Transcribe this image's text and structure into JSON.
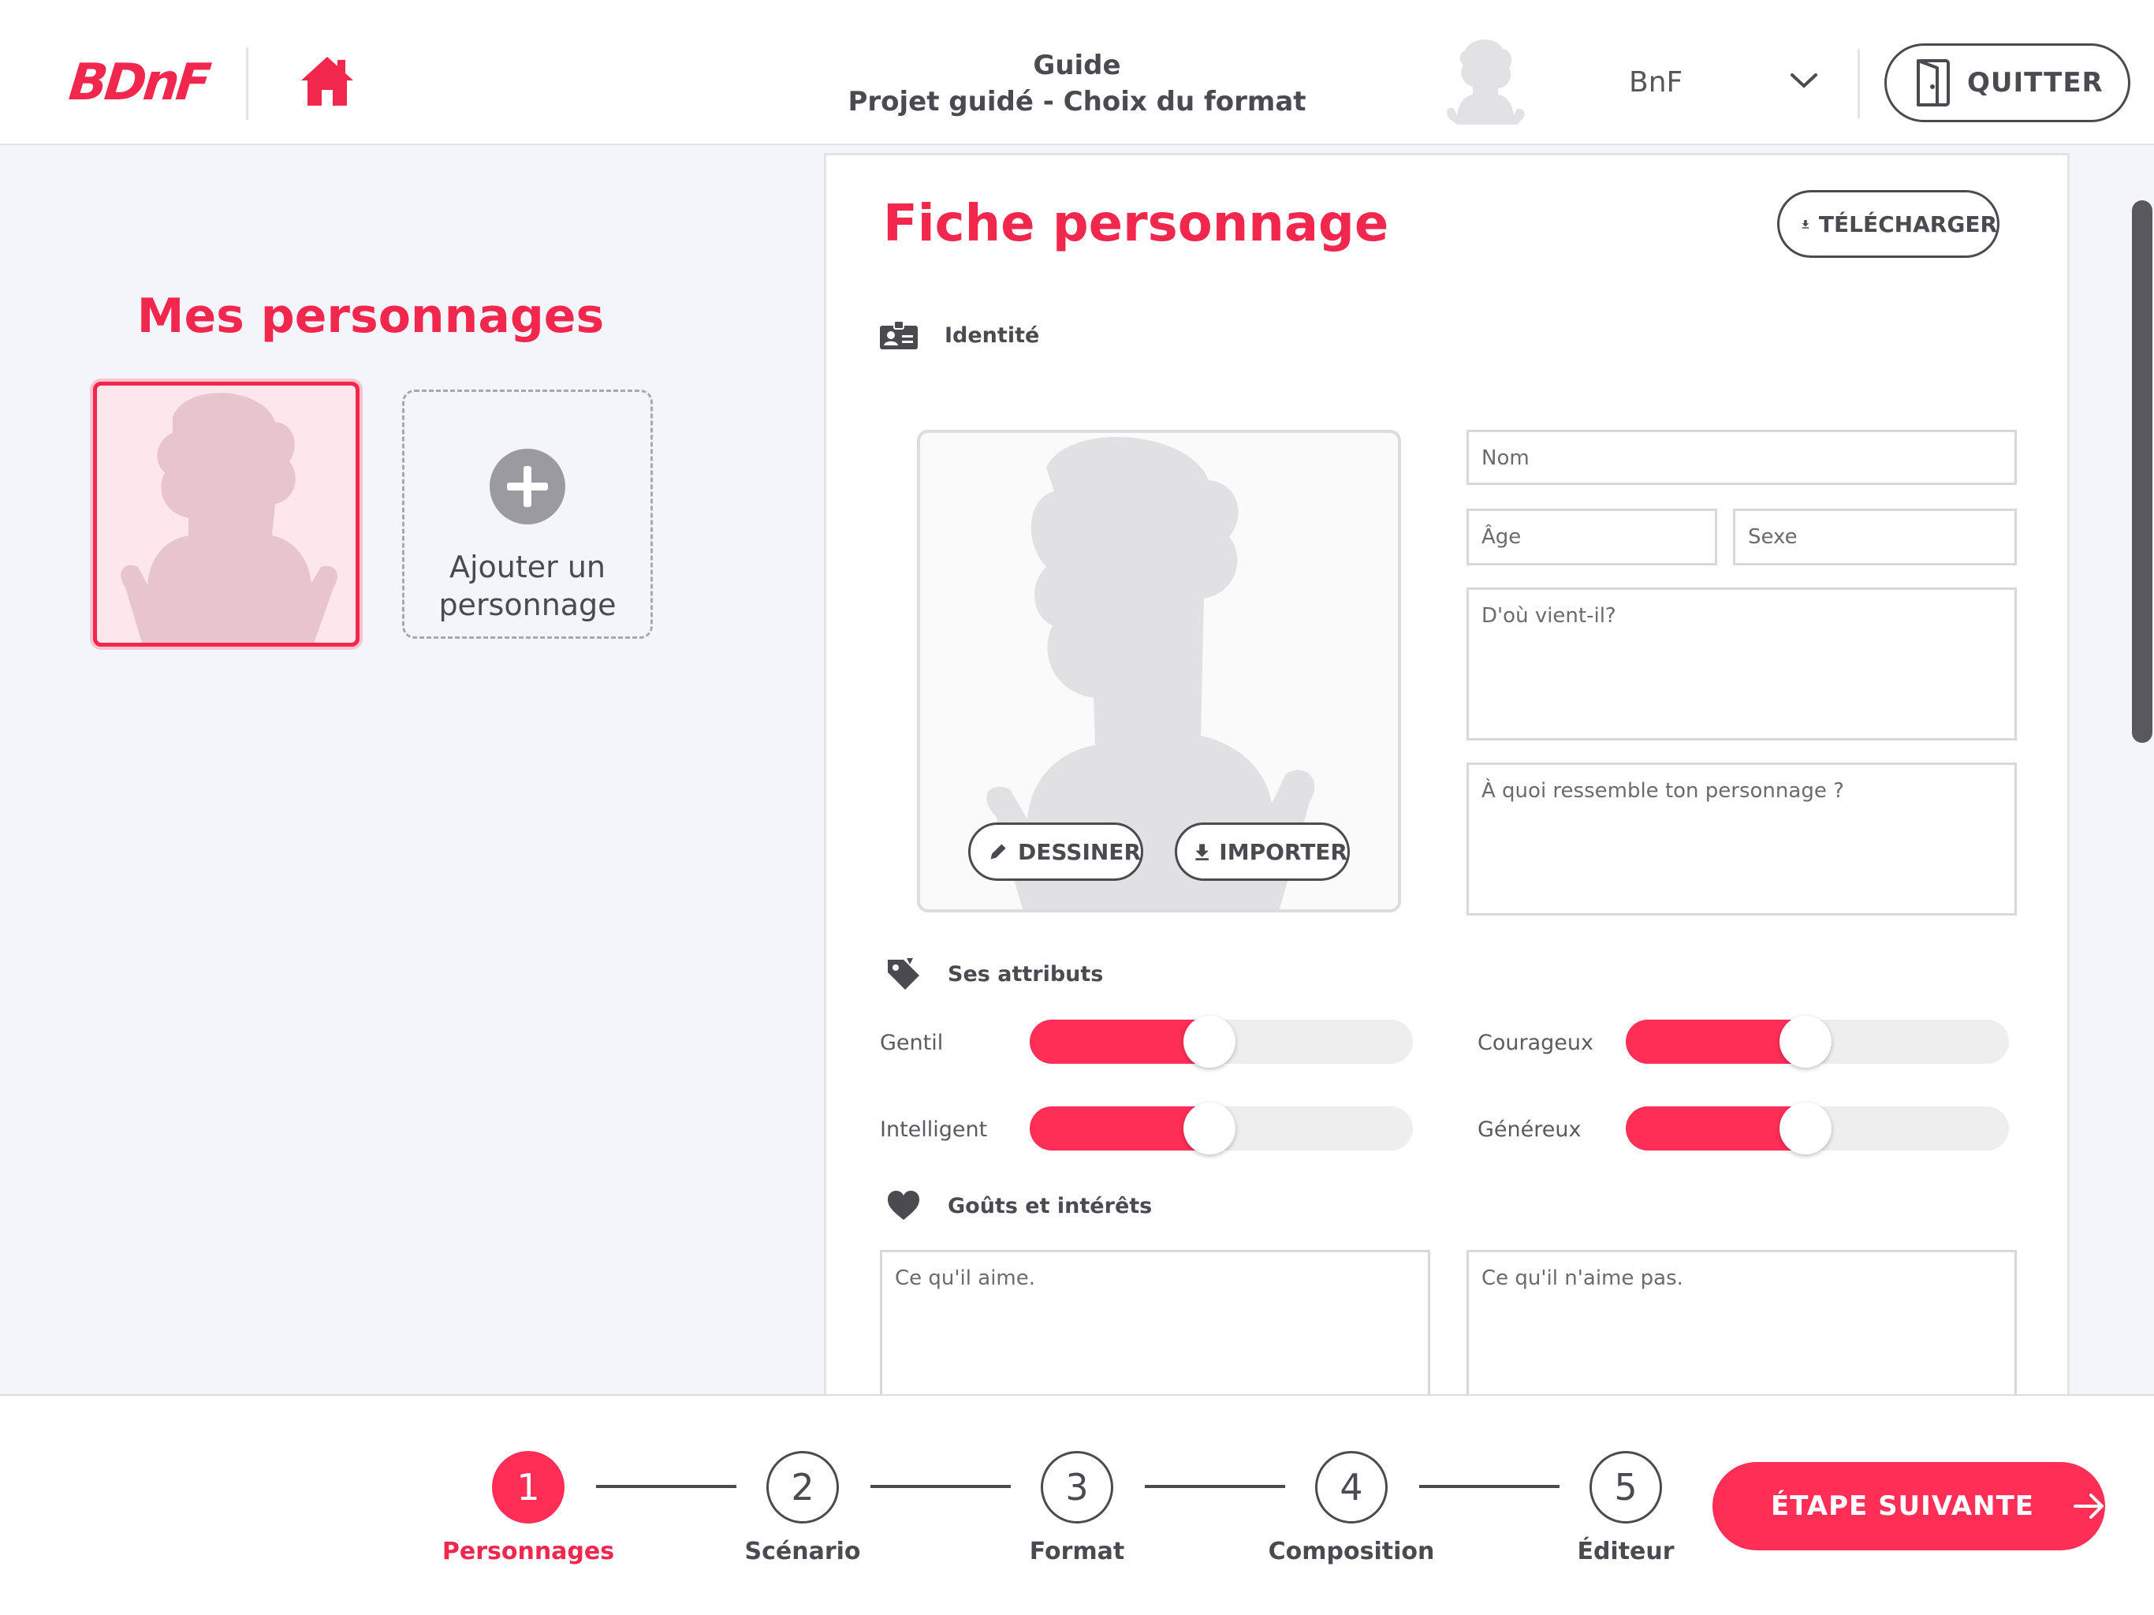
{
  "header": {
    "logo_text": "BDnF",
    "title_line1": "Guide",
    "title_line2": "Projet guidé - Choix du format",
    "user_name": "BnF",
    "quit_label": "QUITTER"
  },
  "left": {
    "title": "Mes personnages",
    "add_label_line1": "Ajouter un",
    "add_label_line2": "personnage"
  },
  "form": {
    "title": "Fiche personnage",
    "download_label": "TÉLÉCHARGER",
    "identity_label": "Identité",
    "draw_label": "DESSINER",
    "import_label": "IMPORTER",
    "fields": {
      "nom": "Nom",
      "age": "Âge",
      "sexe": "Sexe",
      "origin": "D'où vient-il?",
      "appearance": "À quoi ressemble ton personnage ?"
    },
    "attributes_label": "Ses attributs",
    "attributes": [
      {
        "label": "Gentil",
        "value": 0.47
      },
      {
        "label": "Courageux",
        "value": 0.47
      },
      {
        "label": "Intelligent",
        "value": 0.47
      },
      {
        "label": "Généreux",
        "value": 0.47
      }
    ],
    "tastes_label": "Goûts et intérêts",
    "likes_placeholder": "Ce qu'il aime.",
    "dislikes_placeholder": "Ce qu'il n'aime pas."
  },
  "steps": [
    {
      "number": "1",
      "name": "Personnages",
      "active": true
    },
    {
      "number": "2",
      "name": "Scénario",
      "active": false
    },
    {
      "number": "3",
      "name": "Format",
      "active": false
    },
    {
      "number": "4",
      "name": "Composition",
      "active": false
    },
    {
      "number": "5",
      "name": "Éditeur",
      "active": false
    }
  ],
  "next_label": "ÉTAPE SUIVANTE",
  "colors": {
    "accent": "#ff2e56",
    "title_red": "#f2274e",
    "dark": "#4a4a50"
  }
}
